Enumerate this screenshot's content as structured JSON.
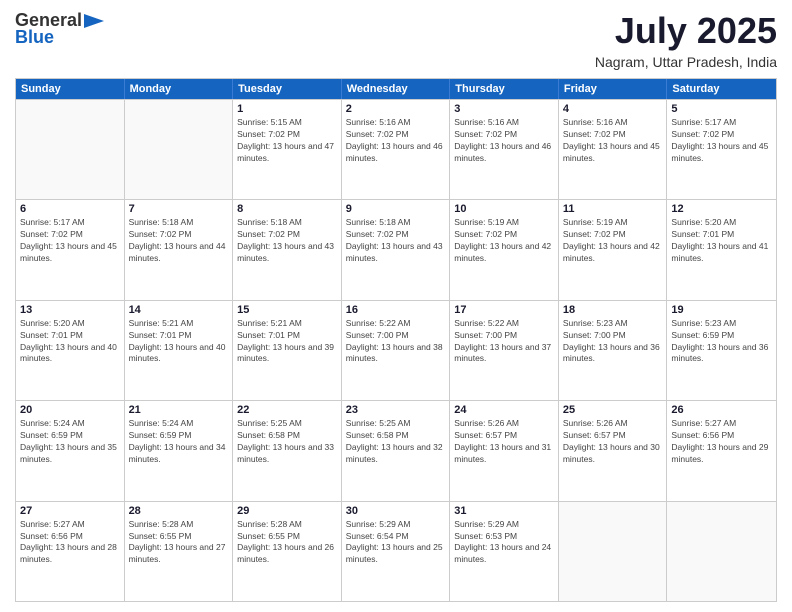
{
  "logo": {
    "general": "General",
    "blue": "Blue"
  },
  "header": {
    "month_year": "July 2025",
    "location": "Nagram, Uttar Pradesh, India"
  },
  "days_of_week": [
    "Sunday",
    "Monday",
    "Tuesday",
    "Wednesday",
    "Thursday",
    "Friday",
    "Saturday"
  ],
  "weeks": [
    [
      {
        "day": "",
        "info": ""
      },
      {
        "day": "",
        "info": ""
      },
      {
        "day": "1",
        "info": "Sunrise: 5:15 AM\nSunset: 7:02 PM\nDaylight: 13 hours and 47 minutes."
      },
      {
        "day": "2",
        "info": "Sunrise: 5:16 AM\nSunset: 7:02 PM\nDaylight: 13 hours and 46 minutes."
      },
      {
        "day": "3",
        "info": "Sunrise: 5:16 AM\nSunset: 7:02 PM\nDaylight: 13 hours and 46 minutes."
      },
      {
        "day": "4",
        "info": "Sunrise: 5:16 AM\nSunset: 7:02 PM\nDaylight: 13 hours and 45 minutes."
      },
      {
        "day": "5",
        "info": "Sunrise: 5:17 AM\nSunset: 7:02 PM\nDaylight: 13 hours and 45 minutes."
      }
    ],
    [
      {
        "day": "6",
        "info": "Sunrise: 5:17 AM\nSunset: 7:02 PM\nDaylight: 13 hours and 45 minutes."
      },
      {
        "day": "7",
        "info": "Sunrise: 5:18 AM\nSunset: 7:02 PM\nDaylight: 13 hours and 44 minutes."
      },
      {
        "day": "8",
        "info": "Sunrise: 5:18 AM\nSunset: 7:02 PM\nDaylight: 13 hours and 43 minutes."
      },
      {
        "day": "9",
        "info": "Sunrise: 5:18 AM\nSunset: 7:02 PM\nDaylight: 13 hours and 43 minutes."
      },
      {
        "day": "10",
        "info": "Sunrise: 5:19 AM\nSunset: 7:02 PM\nDaylight: 13 hours and 42 minutes."
      },
      {
        "day": "11",
        "info": "Sunrise: 5:19 AM\nSunset: 7:02 PM\nDaylight: 13 hours and 42 minutes."
      },
      {
        "day": "12",
        "info": "Sunrise: 5:20 AM\nSunset: 7:01 PM\nDaylight: 13 hours and 41 minutes."
      }
    ],
    [
      {
        "day": "13",
        "info": "Sunrise: 5:20 AM\nSunset: 7:01 PM\nDaylight: 13 hours and 40 minutes."
      },
      {
        "day": "14",
        "info": "Sunrise: 5:21 AM\nSunset: 7:01 PM\nDaylight: 13 hours and 40 minutes."
      },
      {
        "day": "15",
        "info": "Sunrise: 5:21 AM\nSunset: 7:01 PM\nDaylight: 13 hours and 39 minutes."
      },
      {
        "day": "16",
        "info": "Sunrise: 5:22 AM\nSunset: 7:00 PM\nDaylight: 13 hours and 38 minutes."
      },
      {
        "day": "17",
        "info": "Sunrise: 5:22 AM\nSunset: 7:00 PM\nDaylight: 13 hours and 37 minutes."
      },
      {
        "day": "18",
        "info": "Sunrise: 5:23 AM\nSunset: 7:00 PM\nDaylight: 13 hours and 36 minutes."
      },
      {
        "day": "19",
        "info": "Sunrise: 5:23 AM\nSunset: 6:59 PM\nDaylight: 13 hours and 36 minutes."
      }
    ],
    [
      {
        "day": "20",
        "info": "Sunrise: 5:24 AM\nSunset: 6:59 PM\nDaylight: 13 hours and 35 minutes."
      },
      {
        "day": "21",
        "info": "Sunrise: 5:24 AM\nSunset: 6:59 PM\nDaylight: 13 hours and 34 minutes."
      },
      {
        "day": "22",
        "info": "Sunrise: 5:25 AM\nSunset: 6:58 PM\nDaylight: 13 hours and 33 minutes."
      },
      {
        "day": "23",
        "info": "Sunrise: 5:25 AM\nSunset: 6:58 PM\nDaylight: 13 hours and 32 minutes."
      },
      {
        "day": "24",
        "info": "Sunrise: 5:26 AM\nSunset: 6:57 PM\nDaylight: 13 hours and 31 minutes."
      },
      {
        "day": "25",
        "info": "Sunrise: 5:26 AM\nSunset: 6:57 PM\nDaylight: 13 hours and 30 minutes."
      },
      {
        "day": "26",
        "info": "Sunrise: 5:27 AM\nSunset: 6:56 PM\nDaylight: 13 hours and 29 minutes."
      }
    ],
    [
      {
        "day": "27",
        "info": "Sunrise: 5:27 AM\nSunset: 6:56 PM\nDaylight: 13 hours and 28 minutes."
      },
      {
        "day": "28",
        "info": "Sunrise: 5:28 AM\nSunset: 6:55 PM\nDaylight: 13 hours and 27 minutes."
      },
      {
        "day": "29",
        "info": "Sunrise: 5:28 AM\nSunset: 6:55 PM\nDaylight: 13 hours and 26 minutes."
      },
      {
        "day": "30",
        "info": "Sunrise: 5:29 AM\nSunset: 6:54 PM\nDaylight: 13 hours and 25 minutes."
      },
      {
        "day": "31",
        "info": "Sunrise: 5:29 AM\nSunset: 6:53 PM\nDaylight: 13 hours and 24 minutes."
      },
      {
        "day": "",
        "info": ""
      },
      {
        "day": "",
        "info": ""
      }
    ]
  ]
}
